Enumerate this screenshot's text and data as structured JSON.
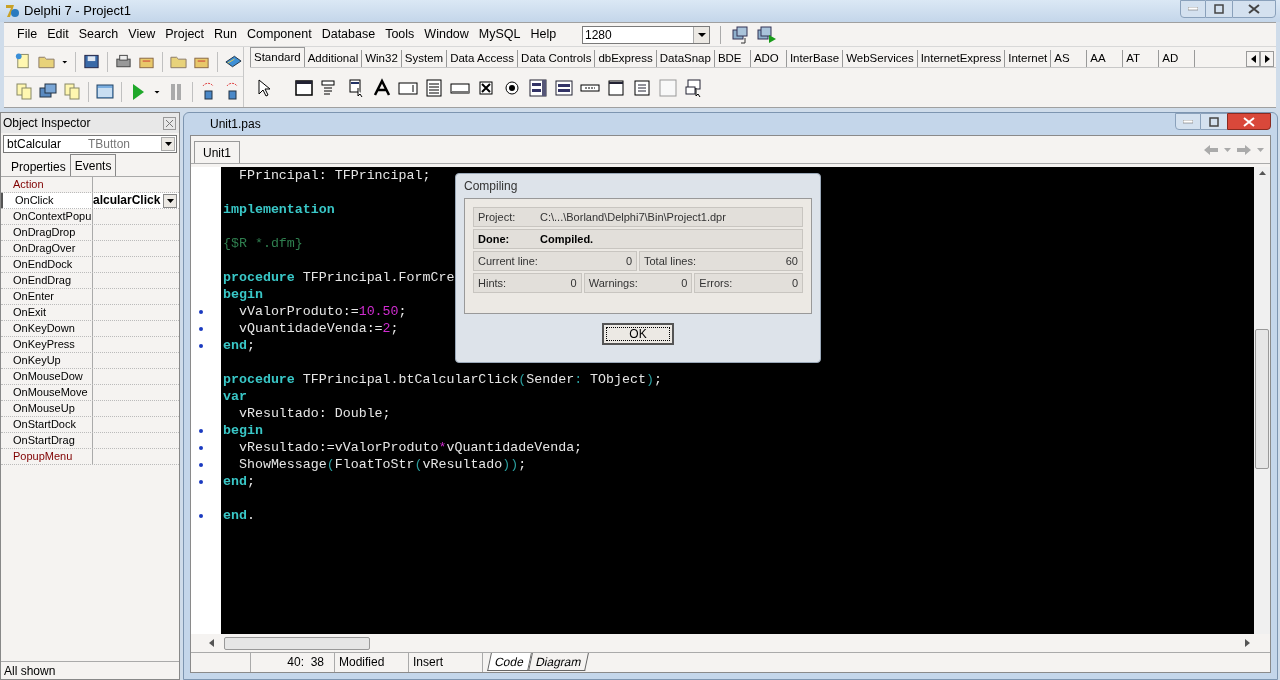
{
  "window": {
    "title": "Delphi 7 - Project1"
  },
  "menu": [
    "File",
    "Edit",
    "Search",
    "View",
    "Project",
    "Run",
    "Component",
    "Database",
    "Tools",
    "Window",
    "MySQL",
    "Help"
  ],
  "desktop_combo": {
    "value": "1280"
  },
  "palette_tabs": [
    {
      "label": "Standard",
      "selected": true
    },
    {
      "label": "Additional",
      "selected": false
    },
    {
      "label": "Win32",
      "selected": false
    },
    {
      "label": "System",
      "selected": false
    },
    {
      "label": "Data Access",
      "selected": false
    },
    {
      "label": "Data Controls",
      "selected": false
    },
    {
      "label": "dbExpress",
      "selected": false
    },
    {
      "label": "DataSnap",
      "selected": false
    },
    {
      "label": "BDE",
      "selected": false
    },
    {
      "label": "ADO",
      "selected": false
    },
    {
      "label": "InterBase",
      "selected": false
    },
    {
      "label": "WebServices",
      "selected": false
    },
    {
      "label": "InternetExpress",
      "selected": false
    },
    {
      "label": "Internet",
      "selected": false
    },
    {
      "label": "AS",
      "selected": false
    },
    {
      "label": "AA",
      "selected": false
    },
    {
      "label": "AT",
      "selected": false
    },
    {
      "label": "AD",
      "selected": false
    }
  ],
  "object_inspector": {
    "title": "Object Inspector",
    "component": {
      "name": "btCalcular",
      "type": "TButton"
    },
    "tabs": [
      {
        "label": "Properties",
        "selected": false
      },
      {
        "label": "Events",
        "selected": true
      }
    ],
    "events": [
      {
        "name": "Action",
        "kind": "link",
        "selected": false
      },
      {
        "name": "OnClick",
        "kind": "event",
        "selected": true,
        "value": "alcularClick"
      },
      {
        "name": "OnContextPopu",
        "kind": "event",
        "selected": false
      },
      {
        "name": "OnDragDrop",
        "kind": "event",
        "selected": false
      },
      {
        "name": "OnDragOver",
        "kind": "event",
        "selected": false
      },
      {
        "name": "OnEndDock",
        "kind": "event",
        "selected": false
      },
      {
        "name": "OnEndDrag",
        "kind": "event",
        "selected": false
      },
      {
        "name": "OnEnter",
        "kind": "event",
        "selected": false
      },
      {
        "name": "OnExit",
        "kind": "event",
        "selected": false
      },
      {
        "name": "OnKeyDown",
        "kind": "event",
        "selected": false
      },
      {
        "name": "OnKeyPress",
        "kind": "event",
        "selected": false
      },
      {
        "name": "OnKeyUp",
        "kind": "event",
        "selected": false
      },
      {
        "name": "OnMouseDow",
        "kind": "event",
        "selected": false
      },
      {
        "name": "OnMouseMove",
        "kind": "event",
        "selected": false
      },
      {
        "name": "OnMouseUp",
        "kind": "event",
        "selected": false
      },
      {
        "name": "OnStartDock",
        "kind": "event",
        "selected": false
      },
      {
        "name": "OnStartDrag",
        "kind": "event",
        "selected": false
      },
      {
        "name": "PopupMenu",
        "kind": "link",
        "selected": false
      }
    ],
    "status": "All shown"
  },
  "editor": {
    "title": "Unit1.pas",
    "tabs": [
      {
        "label": "Unit1",
        "selected": true
      }
    ],
    "lines": [
      {
        "marked": false,
        "segments": [
          {
            "kind": "id",
            "text": "  FPrincipal: TFPrincipal;"
          }
        ]
      },
      {
        "marked": false
      },
      {
        "marked": false,
        "segments": [
          {
            "kind": "kw",
            "text": "implementation"
          }
        ]
      },
      {
        "marked": false
      },
      {
        "marked": false,
        "segments": [
          {
            "kind": "comment",
            "text": "{$R *.dfm}"
          }
        ]
      },
      {
        "marked": false
      },
      {
        "marked": false,
        "segments": [
          {
            "kind": "kw",
            "text": "procedure"
          },
          {
            "kind": "id",
            "text": " TFPrincipal.FormCre"
          }
        ]
      },
      {
        "marked": false,
        "segments": [
          {
            "kind": "kw",
            "text": "begin"
          }
        ]
      },
      {
        "marked": true,
        "segments": [
          {
            "kind": "id",
            "text": "  vValorProduto:="
          },
          {
            "kind": "num",
            "text": "10.50"
          },
          {
            "kind": "id",
            "text": ";"
          }
        ]
      },
      {
        "marked": true,
        "segments": [
          {
            "kind": "id",
            "text": "  vQuantidadeVenda:="
          },
          {
            "kind": "num",
            "text": "2"
          },
          {
            "kind": "id",
            "text": ";"
          }
        ]
      },
      {
        "marked": true,
        "segments": [
          {
            "kind": "kw",
            "text": "end"
          },
          {
            "kind": "id",
            "text": ";"
          }
        ]
      },
      {
        "marked": false
      },
      {
        "marked": false,
        "segments": [
          {
            "kind": "kw",
            "text": "procedure"
          },
          {
            "kind": "id",
            "text": " TFPrincipal.btCalcularClick"
          },
          {
            "kind": "sym",
            "text": "("
          },
          {
            "kind": "id",
            "text": "Sender"
          },
          {
            "kind": "sym",
            "text": ": "
          },
          {
            "kind": "id",
            "text": "TObject"
          },
          {
            "kind": "sym",
            "text": ")"
          },
          {
            "kind": "id",
            "text": ";"
          }
        ]
      },
      {
        "marked": false,
        "segments": [
          {
            "kind": "kw",
            "text": "var"
          }
        ]
      },
      {
        "marked": false,
        "segments": [
          {
            "kind": "id",
            "text": "  vResultado: Double;"
          }
        ]
      },
      {
        "marked": true,
        "segments": [
          {
            "kind": "kw",
            "text": "begin"
          }
        ]
      },
      {
        "marked": true,
        "segments": [
          {
            "kind": "id",
            "text": "  vResultado:=vValorProduto"
          },
          {
            "kind": "num",
            "text": "*"
          },
          {
            "kind": "id",
            "text": "vQuantidadeVenda;"
          }
        ]
      },
      {
        "marked": true,
        "segments": [
          {
            "kind": "id",
            "text": "  ShowMessage"
          },
          {
            "kind": "sym",
            "text": "("
          },
          {
            "kind": "id",
            "text": "FloatToStr"
          },
          {
            "kind": "sym",
            "text": "("
          },
          {
            "kind": "id",
            "text": "vResultado"
          },
          {
            "kind": "sym",
            "text": "))"
          },
          {
            "kind": "id",
            "text": ";"
          }
        ]
      },
      {
        "marked": true,
        "segments": [
          {
            "kind": "kw",
            "text": "end"
          },
          {
            "kind": "id",
            "text": ";"
          }
        ]
      },
      {
        "marked": false
      },
      {
        "marked": true,
        "segments": [
          {
            "kind": "kw",
            "text": "end"
          },
          {
            "kind": "id",
            "text": "."
          }
        ]
      }
    ],
    "status_bar": {
      "position": "40:  38",
      "modified": "Modified",
      "mode": "Insert",
      "view_tabs": [
        {
          "label": "Code",
          "selected": true
        },
        {
          "label": "Diagram",
          "selected": false
        }
      ]
    }
  },
  "dialog": {
    "title": "Compiling",
    "project_label": "Project:",
    "project_value": "C:\\...\\Borland\\Delphi7\\Bin\\Project1.dpr",
    "done_label": "Done:",
    "done_value": "Compiled.",
    "counters": [
      [
        {
          "label": "Current line:",
          "value": "0"
        },
        {
          "label": "Total lines:",
          "value": "60"
        }
      ],
      [
        {
          "label": "Hints:",
          "value": "0"
        },
        {
          "label": "Warnings:",
          "value": "0"
        },
        {
          "label": "Errors:",
          "value": "0"
        }
      ]
    ],
    "button": "OK"
  }
}
